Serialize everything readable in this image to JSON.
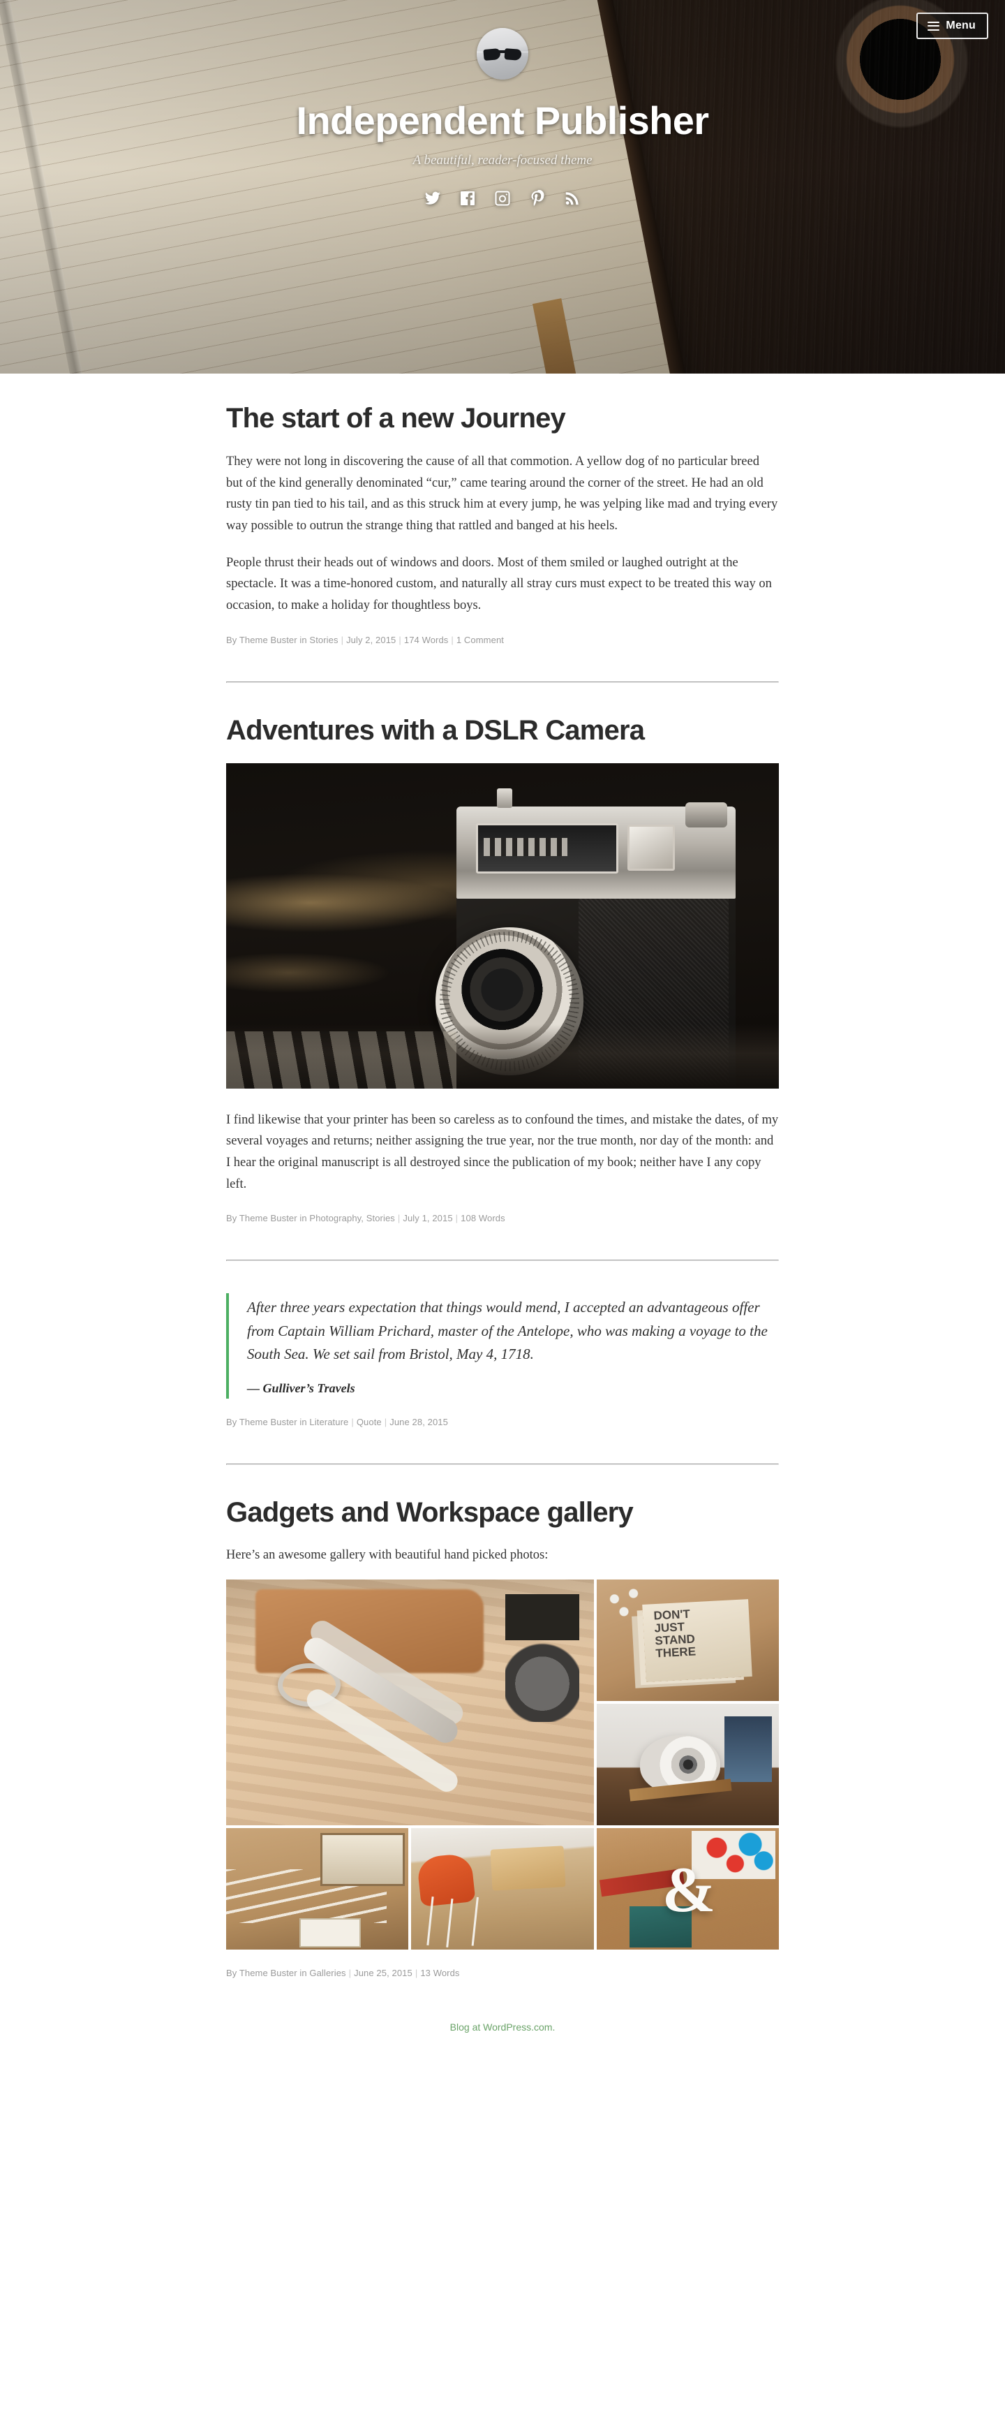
{
  "header": {
    "menu_label": "Menu",
    "menu_icon": "hamburger-icon",
    "site_title": "Independent Publisher",
    "site_description": "A beautiful, reader-focused theme",
    "avatar_alt": "site-avatar",
    "social_links": [
      {
        "name": "twitter",
        "label": "Twitter"
      },
      {
        "name": "facebook",
        "label": "Facebook"
      },
      {
        "name": "instagram",
        "label": "Instagram"
      },
      {
        "name": "pinterest",
        "label": "Pinterest"
      },
      {
        "name": "rss",
        "label": "RSS Feed"
      }
    ]
  },
  "posts": [
    {
      "title": "The start of a new Journey",
      "paragraph_1": "They were not long in discovering the cause of all that commotion. A yellow dog of no particular breed but of the kind generally denominated “cur,” came tearing around the corner of the street. He had an old rusty tin pan tied to his tail, and as this struck him at every jump, he was yelping like mad and trying every way possible to outrun the strange thing that rattled and banged at his heels.",
      "paragraph_2": "People thrust their heads out of windows and doors. Most of them smiled or laughed outright at the spectacle. It was a time-honored custom, and naturally all stray curs must expect to be treated this way on occasion, to make a holiday for thoughtless boys.",
      "meta": {
        "byline": "By Theme Buster in Stories",
        "date": "July 2, 2015",
        "words": "174 Words",
        "comments": "1 Comment"
      }
    },
    {
      "title": "Adventures with a DSLR Camera",
      "featured_image_alt": "vintage-rangefinder-camera",
      "paragraph_1": "I find likewise that your printer has been so careless as to confound the times, and mistake the dates, of my several voyages and returns; neither assigning the true year, nor the true month, nor day of the month: and I hear the original manuscript is all destroyed since the publication of my book; neither have I any copy left.",
      "meta": {
        "byline": "By Theme Buster in Photography, Stories",
        "date": "July 1, 2015",
        "words": "108 Words"
      }
    },
    {
      "quote": "After three years expectation that things would mend, I accepted an advantageous offer from Captain William Prichard, master of the Antelope, who was making a voyage to the South Sea. We set sail from Bristol, May 4, 1718.",
      "citation": "— Gulliver’s Travels",
      "meta": {
        "byline": "By Theme Buster in Literature",
        "format": "Quote",
        "date": "June 28, 2015"
      }
    },
    {
      "title": "Gadgets and Workspace gallery",
      "intro": "Here’s an awesome gallery with beautiful hand picked photos:",
      "gallery": [
        {
          "alt": "drafting-compass-on-desk"
        },
        {
          "alt": "dont-just-stand-there-notebooks"
        },
        {
          "alt": "desktop-speaker"
        },
        {
          "alt": "calligraphy-pens-tray"
        },
        {
          "alt": "orange-chair-workspace-desk"
        },
        {
          "alt": "ampersand-and-back-to-school-pennant"
        }
      ],
      "meta": {
        "byline": "By Theme Buster in Galleries",
        "date": "June 25, 2015",
        "words": "13 Words"
      }
    }
  ],
  "footer": {
    "credit": "Blog at WordPress.com."
  },
  "colors": {
    "accent_green": "#4caf62",
    "footer_link": "#6aa368",
    "meta_gray": "#9a9a9a",
    "heading": "#2b2b2b"
  }
}
